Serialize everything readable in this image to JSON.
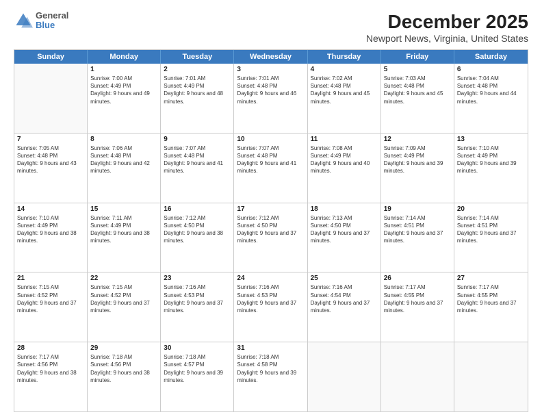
{
  "header": {
    "title": "December 2025",
    "subtitle": "Newport News, Virginia, United States",
    "logo_general": "General",
    "logo_blue": "Blue"
  },
  "weekdays": [
    "Sunday",
    "Monday",
    "Tuesday",
    "Wednesday",
    "Thursday",
    "Friday",
    "Saturday"
  ],
  "rows": [
    [
      {
        "day": "",
        "sunrise": "",
        "sunset": "",
        "daylight": "",
        "empty": true
      },
      {
        "day": "1",
        "sunrise": "Sunrise: 7:00 AM",
        "sunset": "Sunset: 4:49 PM",
        "daylight": "Daylight: 9 hours and 49 minutes."
      },
      {
        "day": "2",
        "sunrise": "Sunrise: 7:01 AM",
        "sunset": "Sunset: 4:49 PM",
        "daylight": "Daylight: 9 hours and 48 minutes."
      },
      {
        "day": "3",
        "sunrise": "Sunrise: 7:01 AM",
        "sunset": "Sunset: 4:48 PM",
        "daylight": "Daylight: 9 hours and 46 minutes."
      },
      {
        "day": "4",
        "sunrise": "Sunrise: 7:02 AM",
        "sunset": "Sunset: 4:48 PM",
        "daylight": "Daylight: 9 hours and 45 minutes."
      },
      {
        "day": "5",
        "sunrise": "Sunrise: 7:03 AM",
        "sunset": "Sunset: 4:48 PM",
        "daylight": "Daylight: 9 hours and 45 minutes."
      },
      {
        "day": "6",
        "sunrise": "Sunrise: 7:04 AM",
        "sunset": "Sunset: 4:48 PM",
        "daylight": "Daylight: 9 hours and 44 minutes."
      }
    ],
    [
      {
        "day": "7",
        "sunrise": "Sunrise: 7:05 AM",
        "sunset": "Sunset: 4:48 PM",
        "daylight": "Daylight: 9 hours and 43 minutes."
      },
      {
        "day": "8",
        "sunrise": "Sunrise: 7:06 AM",
        "sunset": "Sunset: 4:48 PM",
        "daylight": "Daylight: 9 hours and 42 minutes."
      },
      {
        "day": "9",
        "sunrise": "Sunrise: 7:07 AM",
        "sunset": "Sunset: 4:48 PM",
        "daylight": "Daylight: 9 hours and 41 minutes."
      },
      {
        "day": "10",
        "sunrise": "Sunrise: 7:07 AM",
        "sunset": "Sunset: 4:48 PM",
        "daylight": "Daylight: 9 hours and 41 minutes."
      },
      {
        "day": "11",
        "sunrise": "Sunrise: 7:08 AM",
        "sunset": "Sunset: 4:49 PM",
        "daylight": "Daylight: 9 hours and 40 minutes."
      },
      {
        "day": "12",
        "sunrise": "Sunrise: 7:09 AM",
        "sunset": "Sunset: 4:49 PM",
        "daylight": "Daylight: 9 hours and 39 minutes."
      },
      {
        "day": "13",
        "sunrise": "Sunrise: 7:10 AM",
        "sunset": "Sunset: 4:49 PM",
        "daylight": "Daylight: 9 hours and 39 minutes."
      }
    ],
    [
      {
        "day": "14",
        "sunrise": "Sunrise: 7:10 AM",
        "sunset": "Sunset: 4:49 PM",
        "daylight": "Daylight: 9 hours and 38 minutes."
      },
      {
        "day": "15",
        "sunrise": "Sunrise: 7:11 AM",
        "sunset": "Sunset: 4:49 PM",
        "daylight": "Daylight: 9 hours and 38 minutes."
      },
      {
        "day": "16",
        "sunrise": "Sunrise: 7:12 AM",
        "sunset": "Sunset: 4:50 PM",
        "daylight": "Daylight: 9 hours and 38 minutes."
      },
      {
        "day": "17",
        "sunrise": "Sunrise: 7:12 AM",
        "sunset": "Sunset: 4:50 PM",
        "daylight": "Daylight: 9 hours and 37 minutes."
      },
      {
        "day": "18",
        "sunrise": "Sunrise: 7:13 AM",
        "sunset": "Sunset: 4:50 PM",
        "daylight": "Daylight: 9 hours and 37 minutes."
      },
      {
        "day": "19",
        "sunrise": "Sunrise: 7:14 AM",
        "sunset": "Sunset: 4:51 PM",
        "daylight": "Daylight: 9 hours and 37 minutes."
      },
      {
        "day": "20",
        "sunrise": "Sunrise: 7:14 AM",
        "sunset": "Sunset: 4:51 PM",
        "daylight": "Daylight: 9 hours and 37 minutes."
      }
    ],
    [
      {
        "day": "21",
        "sunrise": "Sunrise: 7:15 AM",
        "sunset": "Sunset: 4:52 PM",
        "daylight": "Daylight: 9 hours and 37 minutes."
      },
      {
        "day": "22",
        "sunrise": "Sunrise: 7:15 AM",
        "sunset": "Sunset: 4:52 PM",
        "daylight": "Daylight: 9 hours and 37 minutes."
      },
      {
        "day": "23",
        "sunrise": "Sunrise: 7:16 AM",
        "sunset": "Sunset: 4:53 PM",
        "daylight": "Daylight: 9 hours and 37 minutes."
      },
      {
        "day": "24",
        "sunrise": "Sunrise: 7:16 AM",
        "sunset": "Sunset: 4:53 PM",
        "daylight": "Daylight: 9 hours and 37 minutes."
      },
      {
        "day": "25",
        "sunrise": "Sunrise: 7:16 AM",
        "sunset": "Sunset: 4:54 PM",
        "daylight": "Daylight: 9 hours and 37 minutes."
      },
      {
        "day": "26",
        "sunrise": "Sunrise: 7:17 AM",
        "sunset": "Sunset: 4:55 PM",
        "daylight": "Daylight: 9 hours and 37 minutes."
      },
      {
        "day": "27",
        "sunrise": "Sunrise: 7:17 AM",
        "sunset": "Sunset: 4:55 PM",
        "daylight": "Daylight: 9 hours and 37 minutes."
      }
    ],
    [
      {
        "day": "28",
        "sunrise": "Sunrise: 7:17 AM",
        "sunset": "Sunset: 4:56 PM",
        "daylight": "Daylight: 9 hours and 38 minutes."
      },
      {
        "day": "29",
        "sunrise": "Sunrise: 7:18 AM",
        "sunset": "Sunset: 4:56 PM",
        "daylight": "Daylight: 9 hours and 38 minutes."
      },
      {
        "day": "30",
        "sunrise": "Sunrise: 7:18 AM",
        "sunset": "Sunset: 4:57 PM",
        "daylight": "Daylight: 9 hours and 39 minutes."
      },
      {
        "day": "31",
        "sunrise": "Sunrise: 7:18 AM",
        "sunset": "Sunset: 4:58 PM",
        "daylight": "Daylight: 9 hours and 39 minutes."
      },
      {
        "day": "",
        "sunrise": "",
        "sunset": "",
        "daylight": "",
        "empty": true
      },
      {
        "day": "",
        "sunrise": "",
        "sunset": "",
        "daylight": "",
        "empty": true
      },
      {
        "day": "",
        "sunrise": "",
        "sunset": "",
        "daylight": "",
        "empty": true
      }
    ]
  ]
}
